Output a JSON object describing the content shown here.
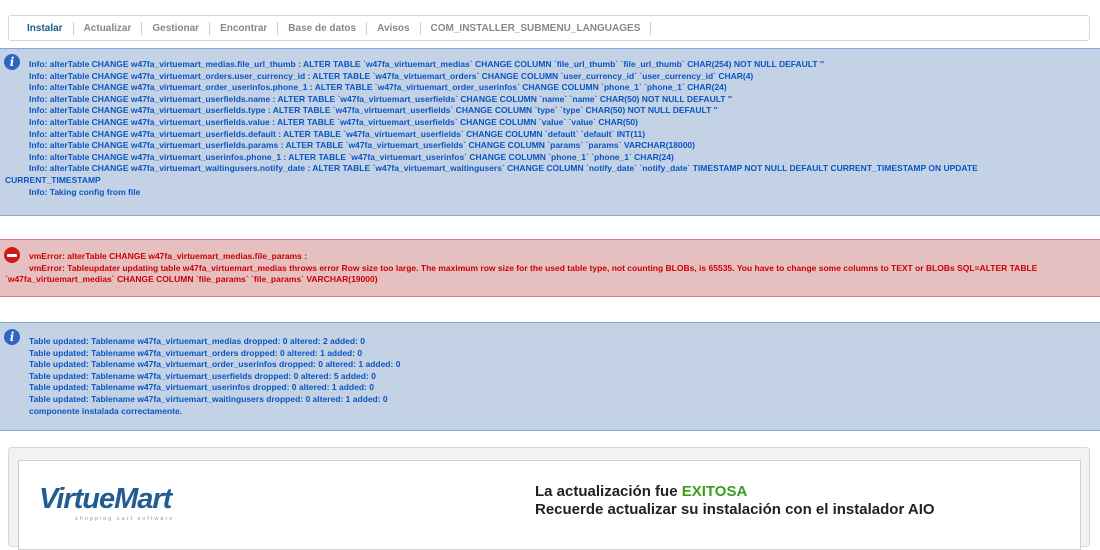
{
  "tabs": [
    {
      "label": "Instalar",
      "active": true
    },
    {
      "label": "Actualizar"
    },
    {
      "label": "Gestionar"
    },
    {
      "label": "Encontrar"
    },
    {
      "label": "Base de datos"
    },
    {
      "label": "Avisos"
    },
    {
      "label": "COM_INSTALLER_SUBMENU_LANGUAGES"
    }
  ],
  "info_messages": [
    "Info: alterTable CHANGE w47fa_virtuemart_medias.file_url_thumb : ALTER TABLE `w47fa_virtuemart_medias` CHANGE COLUMN `file_url_thumb` `file_url_thumb` CHAR(254) NOT NULL DEFAULT ''",
    "Info: alterTable CHANGE w47fa_virtuemart_orders.user_currency_id : ALTER TABLE `w47fa_virtuemart_orders` CHANGE COLUMN `user_currency_id` `user_currency_id` CHAR(4)",
    "Info: alterTable CHANGE w47fa_virtuemart_order_userinfos.phone_1 : ALTER TABLE `w47fa_virtuemart_order_userinfos` CHANGE COLUMN `phone_1` `phone_1` CHAR(24)",
    "Info: alterTable CHANGE w47fa_virtuemart_userfields.name : ALTER TABLE `w47fa_virtuemart_userfields` CHANGE COLUMN `name` `name` CHAR(50) NOT NULL DEFAULT ''",
    "Info: alterTable CHANGE w47fa_virtuemart_userfields.type : ALTER TABLE `w47fa_virtuemart_userfields` CHANGE COLUMN `type` `type` CHAR(50) NOT NULL DEFAULT ''",
    "Info: alterTable CHANGE w47fa_virtuemart_userfields.value : ALTER TABLE `w47fa_virtuemart_userfields` CHANGE COLUMN `value` `value` CHAR(50)",
    "Info: alterTable CHANGE w47fa_virtuemart_userfields.default : ALTER TABLE `w47fa_virtuemart_userfields` CHANGE COLUMN `default` `default` INT(11)",
    "Info: alterTable CHANGE w47fa_virtuemart_userfields.params : ALTER TABLE `w47fa_virtuemart_userfields` CHANGE COLUMN `params` `params` VARCHAR(18000)",
    "Info: alterTable CHANGE w47fa_virtuemart_userinfos.phone_1 : ALTER TABLE `w47fa_virtuemart_userinfos` CHANGE COLUMN `phone_1` `phone_1` CHAR(24)",
    "Info: alterTable CHANGE w47fa_virtuemart_waitingusers.notify_date : ALTER TABLE `w47fa_virtuemart_waitingusers` CHANGE COLUMN `notify_date` `notify_date` TIMESTAMP NOT NULL DEFAULT CURRENT_TIMESTAMP ON UPDATE CURRENT_TIMESTAMP",
    "Info: Taking config from file"
  ],
  "error_messages": [
    "vmError: alterTable CHANGE w47fa_virtuemart_medias.file_params :",
    "vmError: Tableupdater updating table w47fa_virtuemart_medias throws error Row size too large. The maximum row size for the used table type, not counting BLOBs, is 65535. You have to change some columns to TEXT or BLOBs SQL=ALTER TABLE `w47fa_virtuemart_medias` CHANGE COLUMN `file_params` `file_params` VARCHAR(19000)"
  ],
  "table_messages": [
    "Table updated: Tablename w47fa_virtuemart_medias dropped: 0 altered: 2 added: 0",
    "Table updated: Tablename w47fa_virtuemart_orders dropped: 0 altered: 1 added: 0",
    "Table updated: Tablename w47fa_virtuemart_order_userinfos dropped: 0 altered: 1 added: 0",
    "Table updated: Tablename w47fa_virtuemart_userfields dropped: 0 altered: 5 added: 0",
    "Table updated: Tablename w47fa_virtuemart_userinfos dropped: 0 altered: 1 added: 0",
    "Table updated: Tablename w47fa_virtuemart_waitingusers dropped: 0 altered: 1 added: 0",
    "componente instalada correctamente."
  ],
  "panel": {
    "logo_text": "VirtueMart",
    "logo_sub": "shopping cart software",
    "line1_prefix": "La actualización fue ",
    "line1_status": "EXITOSA",
    "line2": "Recuerde actualizar su instalación con el instalador AIO"
  },
  "colors": {
    "info_bg": "#c3d2e5",
    "info_text": "#0b55c4",
    "error_bg": "#e6c0c0",
    "error_text": "#cc0000",
    "success": "#3a9e1a",
    "tab_active": "#185c8f"
  }
}
